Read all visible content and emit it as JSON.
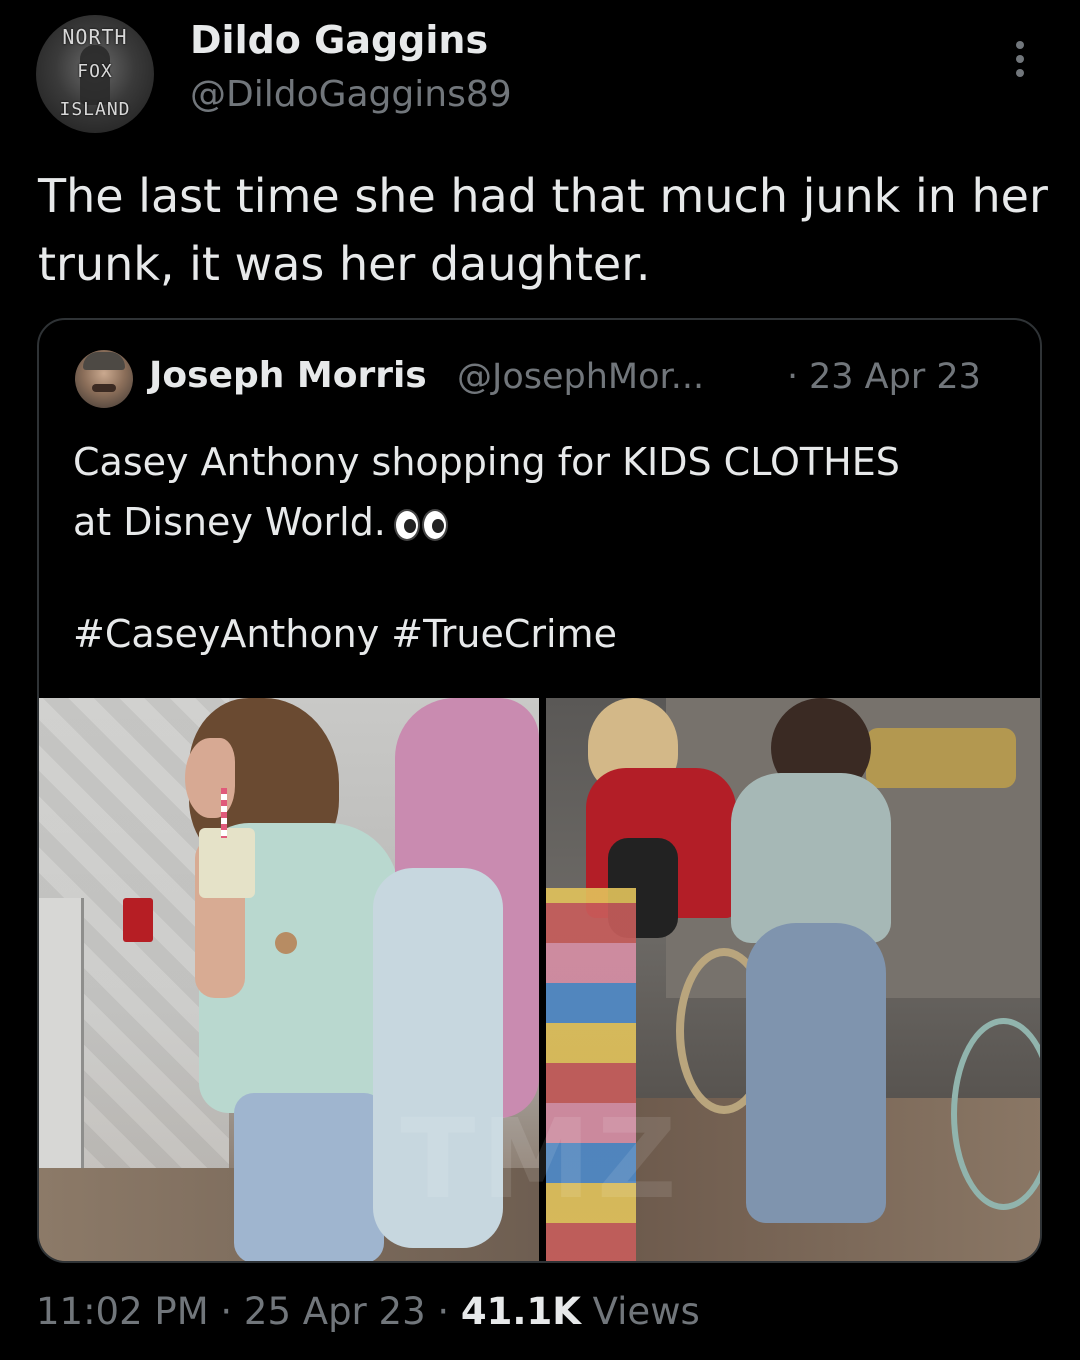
{
  "author": {
    "display_name": "Dildo Gaggins",
    "handle": "@DildoGaggins89",
    "avatar_text": [
      "NORTH",
      "FOX",
      "ISLAND"
    ]
  },
  "tweet": {
    "text": "The last time she had that much junk in her trunk, it was her daughter."
  },
  "quoted": {
    "display_name": "Joseph Morris",
    "handle": "@JosephMor...",
    "separator": "·",
    "date": "23 Apr 23",
    "text_line1": "Casey Anthony shopping for KIDS CLOTHES",
    "text_line2": "at Disney World.",
    "emoji": "eyes-emoji",
    "hashtags": "#CaseyAnthony #TrueCrime",
    "media": {
      "photos": [
        "left-photo",
        "right-photo"
      ],
      "watermark": "TMZ"
    }
  },
  "meta": {
    "time": "11:02 PM",
    "sep1": "·",
    "date": "25 Apr 23",
    "sep2": "·",
    "views_count": "41.1K",
    "views_label": "Views"
  },
  "icons": {
    "more": "more-options-icon"
  },
  "colors": {
    "background": "#000000",
    "primary_text": "#e7e9ea",
    "secondary_text": "#71767b",
    "border": "#2f3336"
  }
}
